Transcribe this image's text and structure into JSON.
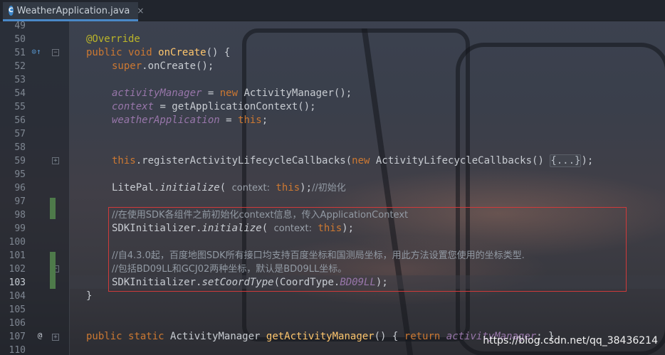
{
  "tab": {
    "icon_letter": "C",
    "title": "WeatherApplication.java",
    "close_glyph": "×"
  },
  "lines": [
    {
      "num": "49"
    },
    {
      "num": "50",
      "tokens": [
        "@Override"
      ]
    },
    {
      "num": "51",
      "tokens": [
        "public",
        "void",
        "onCreate",
        "() {"
      ]
    },
    {
      "num": "52",
      "tokens": [
        "super",
        ".onCreate();"
      ]
    },
    {
      "num": "53"
    },
    {
      "num": "54",
      "tokens": [
        "activityManager",
        " = ",
        "new",
        " ActivityManager();"
      ]
    },
    {
      "num": "55",
      "tokens": [
        "context",
        " = getApplicationContext();"
      ]
    },
    {
      "num": "56",
      "tokens": [
        "weatherApplication",
        " = ",
        "this",
        ";"
      ]
    },
    {
      "num": "57"
    },
    {
      "num": "58"
    },
    {
      "num": "59",
      "tokens": [
        "this",
        ".registerActivityLifecycleCallbacks(",
        "new",
        " ActivityLifecycleCallbacks() ",
        "{...}",
        ");"
      ]
    },
    {
      "num": "95"
    },
    {
      "num": "96",
      "tokens": [
        "LitePal.",
        "initialize",
        "( ",
        "context:",
        " ",
        "this",
        ");",
        "//初始化"
      ]
    },
    {
      "num": "97"
    },
    {
      "num": "98",
      "tokens": [
        "//在使用SDK各组件之前初始化context信息，传入ApplicationContext"
      ]
    },
    {
      "num": "99",
      "tokens": [
        "SDKInitializer.",
        "initialize",
        "( ",
        "context:",
        " ",
        "this",
        ");"
      ]
    },
    {
      "num": "100"
    },
    {
      "num": "101",
      "tokens": [
        "//自4.3.0起，百度地图SDK所有接口均支持百度坐标和国测局坐标，用此方法设置您使用的坐标类型."
      ]
    },
    {
      "num": "102",
      "tokens": [
        "//包括BD09LL和GCJ02两种坐标，默认是BD09LL坐标。"
      ]
    },
    {
      "num": "103",
      "tokens": [
        "SDKInitializer.",
        "setCoordType",
        "(CoordType.",
        "BD09LL",
        ");"
      ]
    },
    {
      "num": "104",
      "tokens": [
        "}"
      ]
    },
    {
      "num": "105"
    },
    {
      "num": "106"
    },
    {
      "num": "107",
      "tokens": [
        "public",
        "static",
        "ActivityManager ",
        "getActivityManager",
        "() { ",
        "return",
        " ",
        "activityManager",
        "; }"
      ]
    },
    {
      "num": "110"
    }
  ],
  "gutter_marks": {
    "override_icon": "⊙↑",
    "implements_icon": "@"
  },
  "watermark": "https://blog.csdn.net/qq_38436214",
  "colors": {
    "keyword": "#cc7832",
    "annotation": "#bbb529",
    "method": "#ffc66d",
    "field": "#9876aa",
    "comment": "#929aa4",
    "highlight_border": "#d03a3a",
    "tab_accent": "#4a88c7"
  }
}
